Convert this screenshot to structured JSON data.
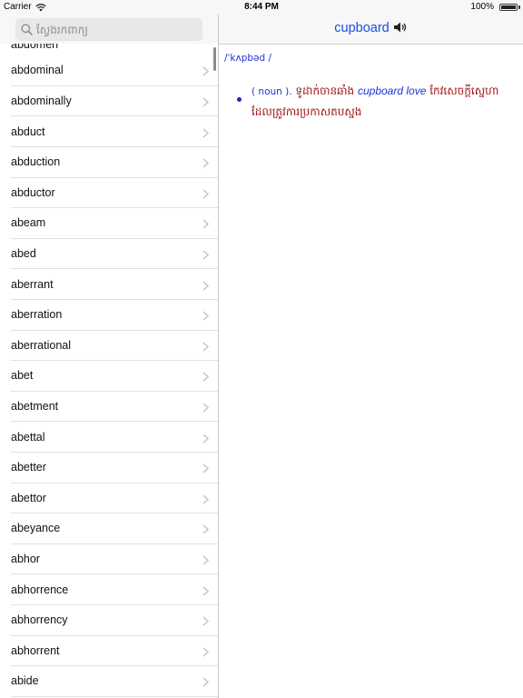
{
  "status_bar": {
    "carrier": "Carrier",
    "time": "8:44 PM",
    "battery": "100%",
    "battery_level": 1.0
  },
  "search": {
    "placeholder": "ស្វែងរកពាក្យ",
    "value": ""
  },
  "word_list": {
    "clipped_top": "abdomen",
    "items": [
      "abdominal",
      "abdominally",
      "abduct",
      "abduction",
      "abductor",
      "abeam",
      "abed",
      "aberrant",
      "aberration",
      "aberrational",
      "abet",
      "abetment",
      "abettal",
      "abetter",
      "abettor",
      "abeyance",
      "abhor",
      "abhorrence",
      "abhorrency",
      "abhorrent",
      "abide"
    ]
  },
  "detail": {
    "title": "cupboard",
    "pronunciation": "/ˈkʌpbəd /",
    "part_of_speech": "( noun ).",
    "definition_1": " ទូដាក់ចានឆាំង ",
    "example": "cupboard love",
    "definition_2": " កែវសេចក្តីស្នេហាដែលត្រូវការប្រកាសតបស្នង"
  },
  "icons": {
    "search": "search-icon",
    "speaker": "speaker-icon",
    "chevron": "chevron-right-icon",
    "wifi": "wifi-icon",
    "battery": "battery-icon"
  },
  "colors": {
    "accent": "#1a4fe0",
    "definition": "#a01010"
  }
}
